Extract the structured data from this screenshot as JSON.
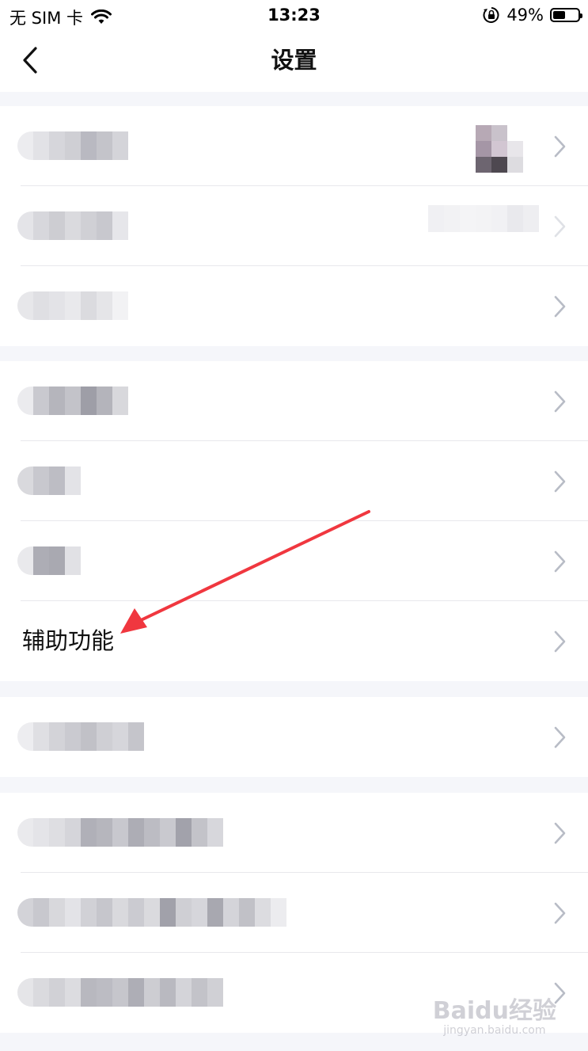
{
  "status_bar": {
    "carrier": "无 SIM 卡",
    "time": "13:23",
    "battery_percent": "49%",
    "battery_level": 0.49,
    "icons": [
      "wifi-icon",
      "orientation-lock-icon",
      "battery-icon"
    ]
  },
  "nav": {
    "title": "设置",
    "back_icon": "chevron-left-icon"
  },
  "sections": [
    {
      "rows": [
        {
          "label": "",
          "redacted": true,
          "has_avatar": true
        },
        {
          "label": "",
          "redacted": true,
          "has_value": true
        },
        {
          "label": "",
          "redacted": true
        }
      ]
    },
    {
      "rows": [
        {
          "label": "",
          "redacted": true
        },
        {
          "label": "",
          "redacted": true
        },
        {
          "label": "",
          "redacted": true
        },
        {
          "label": "辅助功能",
          "redacted": false,
          "highlighted": true
        }
      ]
    },
    {
      "rows": [
        {
          "label": "",
          "redacted": true
        }
      ]
    },
    {
      "rows": [
        {
          "label": "",
          "redacted": true
        },
        {
          "label": "",
          "redacted": true
        },
        {
          "label": "",
          "redacted": true
        }
      ]
    }
  ],
  "watermark": {
    "brand": "Baidu经验",
    "url": "jingyan.baidu.com"
  },
  "colors": {
    "background": "#f5f6fa",
    "row_background": "#ffffff",
    "chevron": "#b8bcc6",
    "annotation_arrow": "#f0373f"
  }
}
